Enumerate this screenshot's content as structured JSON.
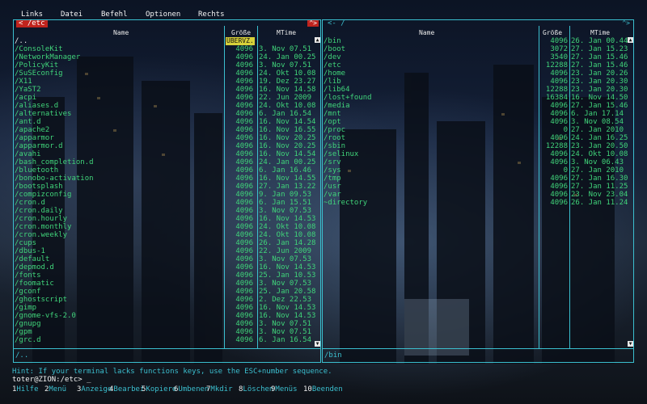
{
  "menubar": {
    "items": [
      {
        "label": "Links"
      },
      {
        "label": "Datei"
      },
      {
        "label": "Befehl"
      },
      {
        "label": "Optionen"
      },
      {
        "label": "Rechts"
      }
    ]
  },
  "left_panel": {
    "path": "< /etc",
    "corner": "^>",
    "columns": {
      "name": "Name",
      "size": "Größe",
      "mtime": "MTime"
    },
    "size_badge": "ÜBERVZ.",
    "status": "/..",
    "rows": [
      {
        "name": "/..",
        "size": "",
        "date": "",
        "updir": true
      },
      {
        "name": "/ConsoleKit",
        "size": "4096",
        "date": "3. Nov 07.51"
      },
      {
        "name": "/NetworkManager",
        "size": "4096",
        "date": "24. Jan 00.25"
      },
      {
        "name": "/PolicyKit",
        "size": "4096",
        "date": "3. Nov 07.51"
      },
      {
        "name": "/SuSEconfig",
        "size": "4096",
        "date": "24. Okt 10.08"
      },
      {
        "name": "/X11",
        "size": "4096",
        "date": "19. Dez 23.27"
      },
      {
        "name": "/YaST2",
        "size": "4096",
        "date": "16. Nov 14.58"
      },
      {
        "name": "/acpi",
        "size": "4096",
        "date": "22. Jun 2009"
      },
      {
        "name": "/aliases.d",
        "size": "4096",
        "date": "24. Okt 10.08"
      },
      {
        "name": "/alternatives",
        "size": "4096",
        "date": "6. Jan 16.54"
      },
      {
        "name": "/ant.d",
        "size": "4096",
        "date": "16. Nov 14.54"
      },
      {
        "name": "/apache2",
        "size": "4096",
        "date": "16. Nov 16.55"
      },
      {
        "name": "/apparmor",
        "size": "4096",
        "date": "16. Nov 20.25"
      },
      {
        "name": "/apparmor.d",
        "size": "4096",
        "date": "16. Nov 20.25"
      },
      {
        "name": "/avahi",
        "size": "4096",
        "date": "16. Nov 14.54"
      },
      {
        "name": "/bash_completion.d",
        "size": "4096",
        "date": "24. Jan 00.25"
      },
      {
        "name": "/bluetooth",
        "size": "4096",
        "date": "6. Jan 16.46"
      },
      {
        "name": "/bonobo-activation",
        "size": "4096",
        "date": "16. Nov 14.55"
      },
      {
        "name": "/bootsplash",
        "size": "4096",
        "date": "27. Jan 13.22"
      },
      {
        "name": "/compizconfig",
        "size": "4096",
        "date": "9. Jan 09.53"
      },
      {
        "name": "/cron.d",
        "size": "4096",
        "date": "6. Jan 15.51"
      },
      {
        "name": "/cron.daily",
        "size": "4096",
        "date": "3. Nov 07.53"
      },
      {
        "name": "/cron.hourly",
        "size": "4096",
        "date": "16. Nov 14.53"
      },
      {
        "name": "/cron.monthly",
        "size": "4096",
        "date": "24. Okt 10.08"
      },
      {
        "name": "/cron.weekly",
        "size": "4096",
        "date": "24. Okt 10.08"
      },
      {
        "name": "/cups",
        "size": "4096",
        "date": "26. Jan 14.28"
      },
      {
        "name": "/dbus-1",
        "size": "4096",
        "date": "22. Jun 2009"
      },
      {
        "name": "/default",
        "size": "4096",
        "date": "3. Nov 07.53"
      },
      {
        "name": "/depmod.d",
        "size": "4096",
        "date": "16. Nov 14.53"
      },
      {
        "name": "/fonts",
        "size": "4096",
        "date": "25. Jan 10.53"
      },
      {
        "name": "/foomatic",
        "size": "4096",
        "date": "3. Nov 07.53"
      },
      {
        "name": "/gconf",
        "size": "4096",
        "date": "25. Jan 20.58"
      },
      {
        "name": "/ghostscript",
        "size": "4096",
        "date": "2. Dez 22.53"
      },
      {
        "name": "/gimp",
        "size": "4096",
        "date": "16. Nov 14.53"
      },
      {
        "name": "/gnome-vfs-2.0",
        "size": "4096",
        "date": "16. Nov 14.53"
      },
      {
        "name": "/gnupg",
        "size": "4096",
        "date": "3. Nov 07.51"
      },
      {
        "name": "/gpm",
        "size": "4096",
        "date": "3. Nov 07.51"
      },
      {
        "name": "/grc.d",
        "size": "4096",
        "date": "6. Jan 16.54"
      }
    ]
  },
  "right_panel": {
    "path": "<- /",
    "corner": "^>",
    "columns": {
      "name": "Name",
      "size": "Größe",
      "mtime": "MTime"
    },
    "status": "/bin",
    "rows": [
      {
        "name": "/bin",
        "size": "4096",
        "date": "26. Jan 00.44"
      },
      {
        "name": "/boot",
        "size": "3072",
        "date": "27. Jan 15.23"
      },
      {
        "name": "/dev",
        "size": "3540",
        "date": "27. Jan 15.46"
      },
      {
        "name": "/etc",
        "size": "12288",
        "date": "27. Jan 15.46"
      },
      {
        "name": "/home",
        "size": "4096",
        "date": "23. Jan 20.26"
      },
      {
        "name": "/lib",
        "size": "4096",
        "date": "23. Jan 20.30"
      },
      {
        "name": "/lib64",
        "size": "12288",
        "date": "23. Jan 20.30"
      },
      {
        "name": "/lost+found",
        "size": "16384",
        "date": "16. Nov 14.50"
      },
      {
        "name": "/media",
        "size": "4096",
        "date": "27. Jan 15.46"
      },
      {
        "name": "/mnt",
        "size": "4096",
        "date": "6. Jan 17.14"
      },
      {
        "name": "/opt",
        "size": "4096",
        "date": "3. Nov 08.54"
      },
      {
        "name": "/proc",
        "size": "0",
        "date": "27. Jan 2010"
      },
      {
        "name": "/root",
        "size": "4096",
        "date": "24. Jan 16.25"
      },
      {
        "name": "/sbin",
        "size": "12288",
        "date": "23. Jan 20.50"
      },
      {
        "name": "/selinux",
        "size": "4096",
        "date": "24. Okt 10.08"
      },
      {
        "name": "/srv",
        "size": "4096",
        "date": "3. Nov 06.43"
      },
      {
        "name": "/sys",
        "size": "0",
        "date": "27. Jan 2010"
      },
      {
        "name": "/tmp",
        "size": "4096",
        "date": "27. Jan 16.30"
      },
      {
        "name": "/usr",
        "size": "4096",
        "date": "27. Jan 11.25"
      },
      {
        "name": "/var",
        "size": "4096",
        "date": "23. Nov 23.04"
      },
      {
        "name": "~directory",
        "size": "4096",
        "date": "26. Jan 11.24"
      }
    ]
  },
  "hint": "Hint: If your terminal lacks functions keys, use the ESC+number sequence.",
  "prompt": "toter@ZION:/etc> _",
  "fkeys": [
    {
      "num": "1",
      "label": "Hilfe"
    },
    {
      "num": "2",
      "label": "Menü"
    },
    {
      "num": "3",
      "label": "Anzeige"
    },
    {
      "num": "4",
      "label": "Bearbei"
    },
    {
      "num": "5",
      "label": "Kopiere"
    },
    {
      "num": "6",
      "label": "Umbenen"
    },
    {
      "num": "7",
      "label": "Mkdir"
    },
    {
      "num": "8",
      "label": "Löschen"
    },
    {
      "num": "9",
      "label": "Menüs"
    },
    {
      "num": "10",
      "label": "Beenden"
    }
  ]
}
